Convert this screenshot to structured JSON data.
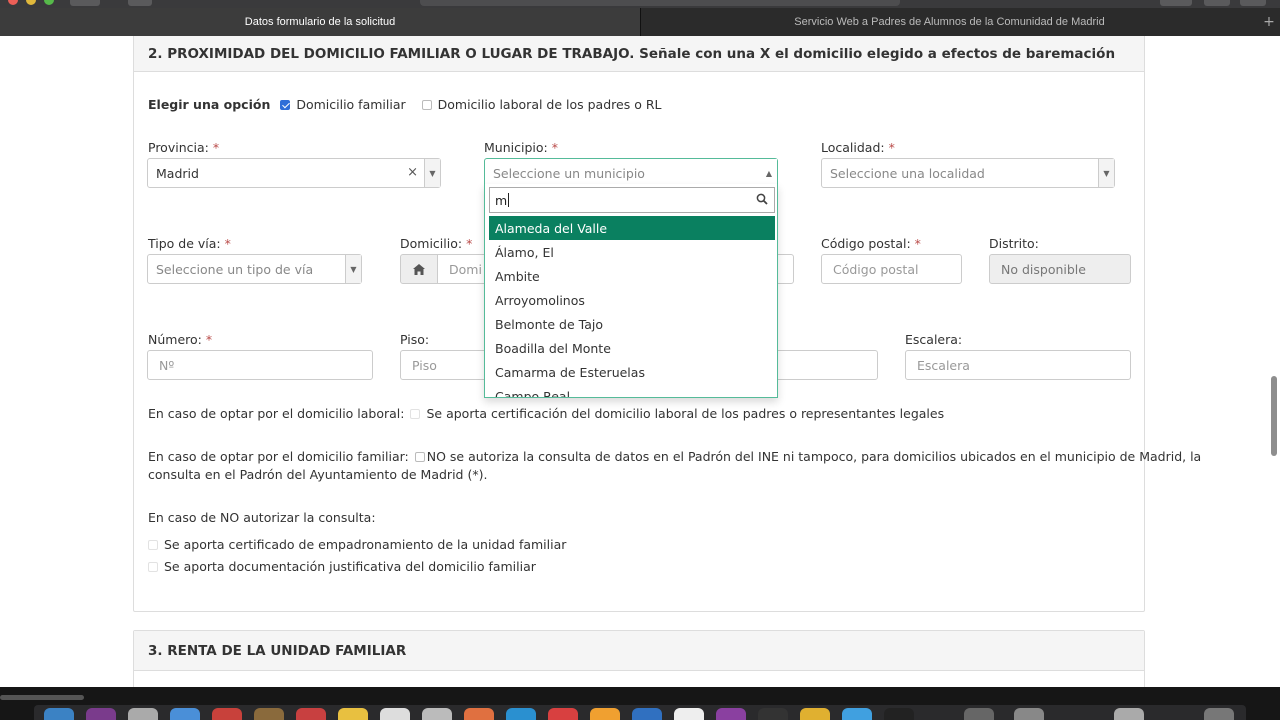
{
  "browser": {
    "tabs": [
      {
        "label": "Datos formulario de la solicitud",
        "active": true
      },
      {
        "label": "Servicio Web a Padres de Alumnos de la Comunidad de Madrid",
        "active": false
      }
    ],
    "new_tab_label": "+"
  },
  "section2": {
    "title": "2. PROXIMIDAD DEL DOMICILIO FAMILIAR O LUGAR DE TRABAJO. Señale con una X el domicilio elegido a efectos de baremación",
    "option_label": "Elegir una opción",
    "option_familiar": "Domicilio familiar",
    "option_familiar_checked": true,
    "option_laboral": "Domicilio laboral de los padres o RL",
    "option_laboral_checked": false,
    "required_mark": "*",
    "provincia": {
      "label": "Provincia:",
      "value": "Madrid",
      "clear": "×"
    },
    "municipio": {
      "label": "Municipio:",
      "placeholder": "Seleccione un municipio"
    },
    "localidad": {
      "label": "Localidad:",
      "placeholder": "Seleccione una localidad"
    },
    "tipo_via": {
      "label": "Tipo de vía:",
      "placeholder": "Seleccione un tipo de vía"
    },
    "domicilio": {
      "label": "Domicilio:",
      "placeholder": "Domi"
    },
    "codigo_postal": {
      "label": "Código postal:",
      "placeholder": "Código postal"
    },
    "distrito": {
      "label": "Distrito:",
      "value": "No disponible"
    },
    "numero": {
      "label": "Número:",
      "placeholder": "Nº"
    },
    "piso": {
      "label": "Piso:",
      "placeholder": "Piso"
    },
    "escalera": {
      "label": "Escalera:",
      "placeholder": "Escalera"
    },
    "laboral_line": {
      "prefix": "En caso de optar por el domicilio laboral:",
      "text": "Se aporta certificación del domicilio laboral de los padres o representantes legales"
    },
    "familiar_line": {
      "prefix": "En caso de optar por el domicilio familiar:",
      "text1": "NO se autoriza la consulta de datos en el Padrón del INE ni tampoco, para domicilios ubicados en el municipio de Madrid, la",
      "text2": "consulta en el Padrón del Ayuntamiento de Madrid (*)."
    },
    "no_autorizar": {
      "heading": "En caso de NO autorizar la consulta:",
      "options": [
        "Se aporta certificado de empadronamiento de la unidad familiar",
        "Se aporta documentación justificativa del domicilio familiar"
      ]
    }
  },
  "municipio_dropdown": {
    "search_value": "m",
    "items": [
      {
        "label": "Alameda del Valle",
        "highlighted": true
      },
      {
        "label": "Álamo, El",
        "highlighted": false
      },
      {
        "label": "Ambite",
        "highlighted": false
      },
      {
        "label": "Arroyomolinos",
        "highlighted": false
      },
      {
        "label": "Belmonte de Tajo",
        "highlighted": false
      },
      {
        "label": "Boadilla del Monte",
        "highlighted": false
      },
      {
        "label": "Camarma de Esteruelas",
        "highlighted": false
      },
      {
        "label": "Campo Real",
        "highlighted": false
      }
    ]
  },
  "section3": {
    "title": "3. RENTA DE LA UNIDAD FAMILIAR"
  },
  "colors": {
    "highlight": "#0a8060",
    "required": "#b94a48",
    "checkbox_on": "#2f6ed8"
  }
}
